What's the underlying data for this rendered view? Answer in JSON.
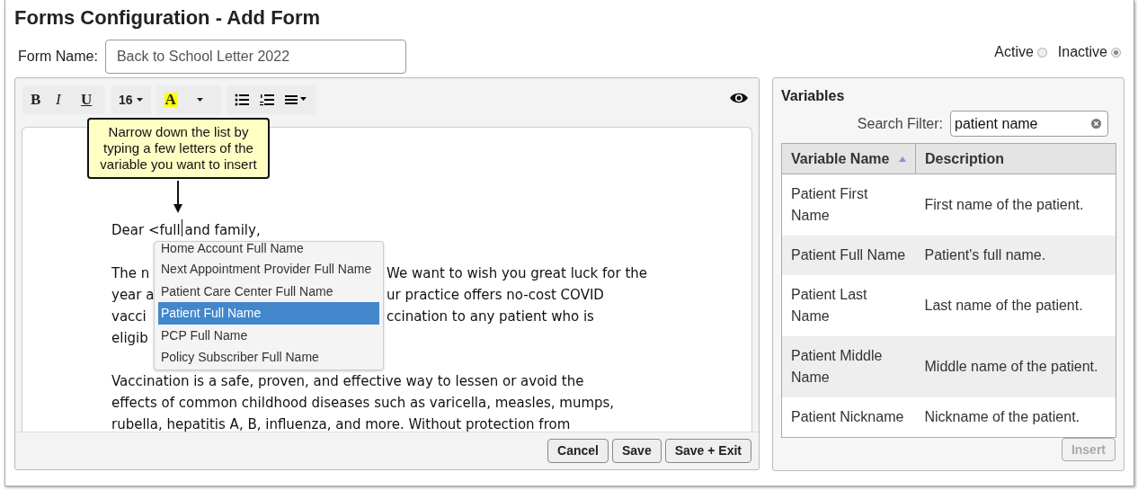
{
  "page": {
    "title": "Forms Configuration - Add Form"
  },
  "form_name": {
    "label": "Form Name:",
    "value": "Back to School Letter 2022"
  },
  "status": [
    {
      "label": "Active",
      "selected": false
    },
    {
      "label": "Inactive",
      "selected": true
    }
  ],
  "toolbar": [
    [
      {
        "kind": "bold",
        "label": "B"
      },
      {
        "kind": "italic",
        "label": "I"
      },
      {
        "kind": "underline",
        "label": "U"
      }
    ],
    [
      {
        "kind": "size",
        "label": "16"
      }
    ],
    [
      {
        "kind": "highlight",
        "label": "A"
      },
      {
        "kind": "split-caret"
      }
    ],
    [
      {
        "kind": "bullets"
      },
      {
        "kind": "numbers"
      },
      {
        "kind": "align"
      }
    ]
  ],
  "callout": {
    "text": "Narrow down the list by typing a few letters of the variable you want to insert"
  },
  "editor": {
    "greeting_typed": "Dear <full",
    "greeting_rest": "and family,",
    "covered_lines": [
      {
        "left": "The n",
        "right": "We want to wish you great luck for the"
      },
      {
        "left": "year a",
        "right": "ur practice offers no-cost COVID"
      },
      {
        "left": "vacci",
        "right": "ccination to any patient who is"
      },
      {
        "left": "eligib"
      }
    ],
    "lines": [
      "Vaccination is a safe, proven, and effective way to lessen or avoid the",
      "effects of common childhood diseases such as varicella, measles, mumps,",
      "rubella, hepatitis A, B, influenza, and more. Without protection from"
    ]
  },
  "autocomplete": [
    {
      "label": "Home Account Full Name",
      "selected": false
    },
    {
      "label": "Next Appointment Provider Full Name",
      "selected": false
    },
    {
      "label": "Patient Care Center Full Name",
      "selected": false
    },
    {
      "label": "Patient Full Name",
      "selected": true
    },
    {
      "label": "PCP Full Name",
      "selected": false
    },
    {
      "label": "Policy Subscriber Full Name",
      "selected": false
    }
  ],
  "buttons": [
    "Cancel",
    "Save",
    "Save + Exit"
  ],
  "variables": {
    "title": "Variables",
    "search_label": "Search Filter:",
    "search_value": "patient name",
    "columns": [
      {
        "label": "Variable Name",
        "sorted": true
      },
      {
        "label": "Description",
        "sorted": false
      }
    ],
    "rows": [
      {
        "name": "Patient First Name",
        "description": "First name of the patient."
      },
      {
        "name": "Patient Full Name",
        "description": "Patient's full name."
      },
      {
        "name": "Patient Last Name",
        "description": "Last name of the patient."
      },
      {
        "name": "Patient Middle Name",
        "description": "Middle name of the patient."
      },
      {
        "name": "Patient Nickname",
        "description": "Nickname of the patient."
      }
    ],
    "insert": {
      "label": "Insert",
      "disabled": true
    }
  }
}
